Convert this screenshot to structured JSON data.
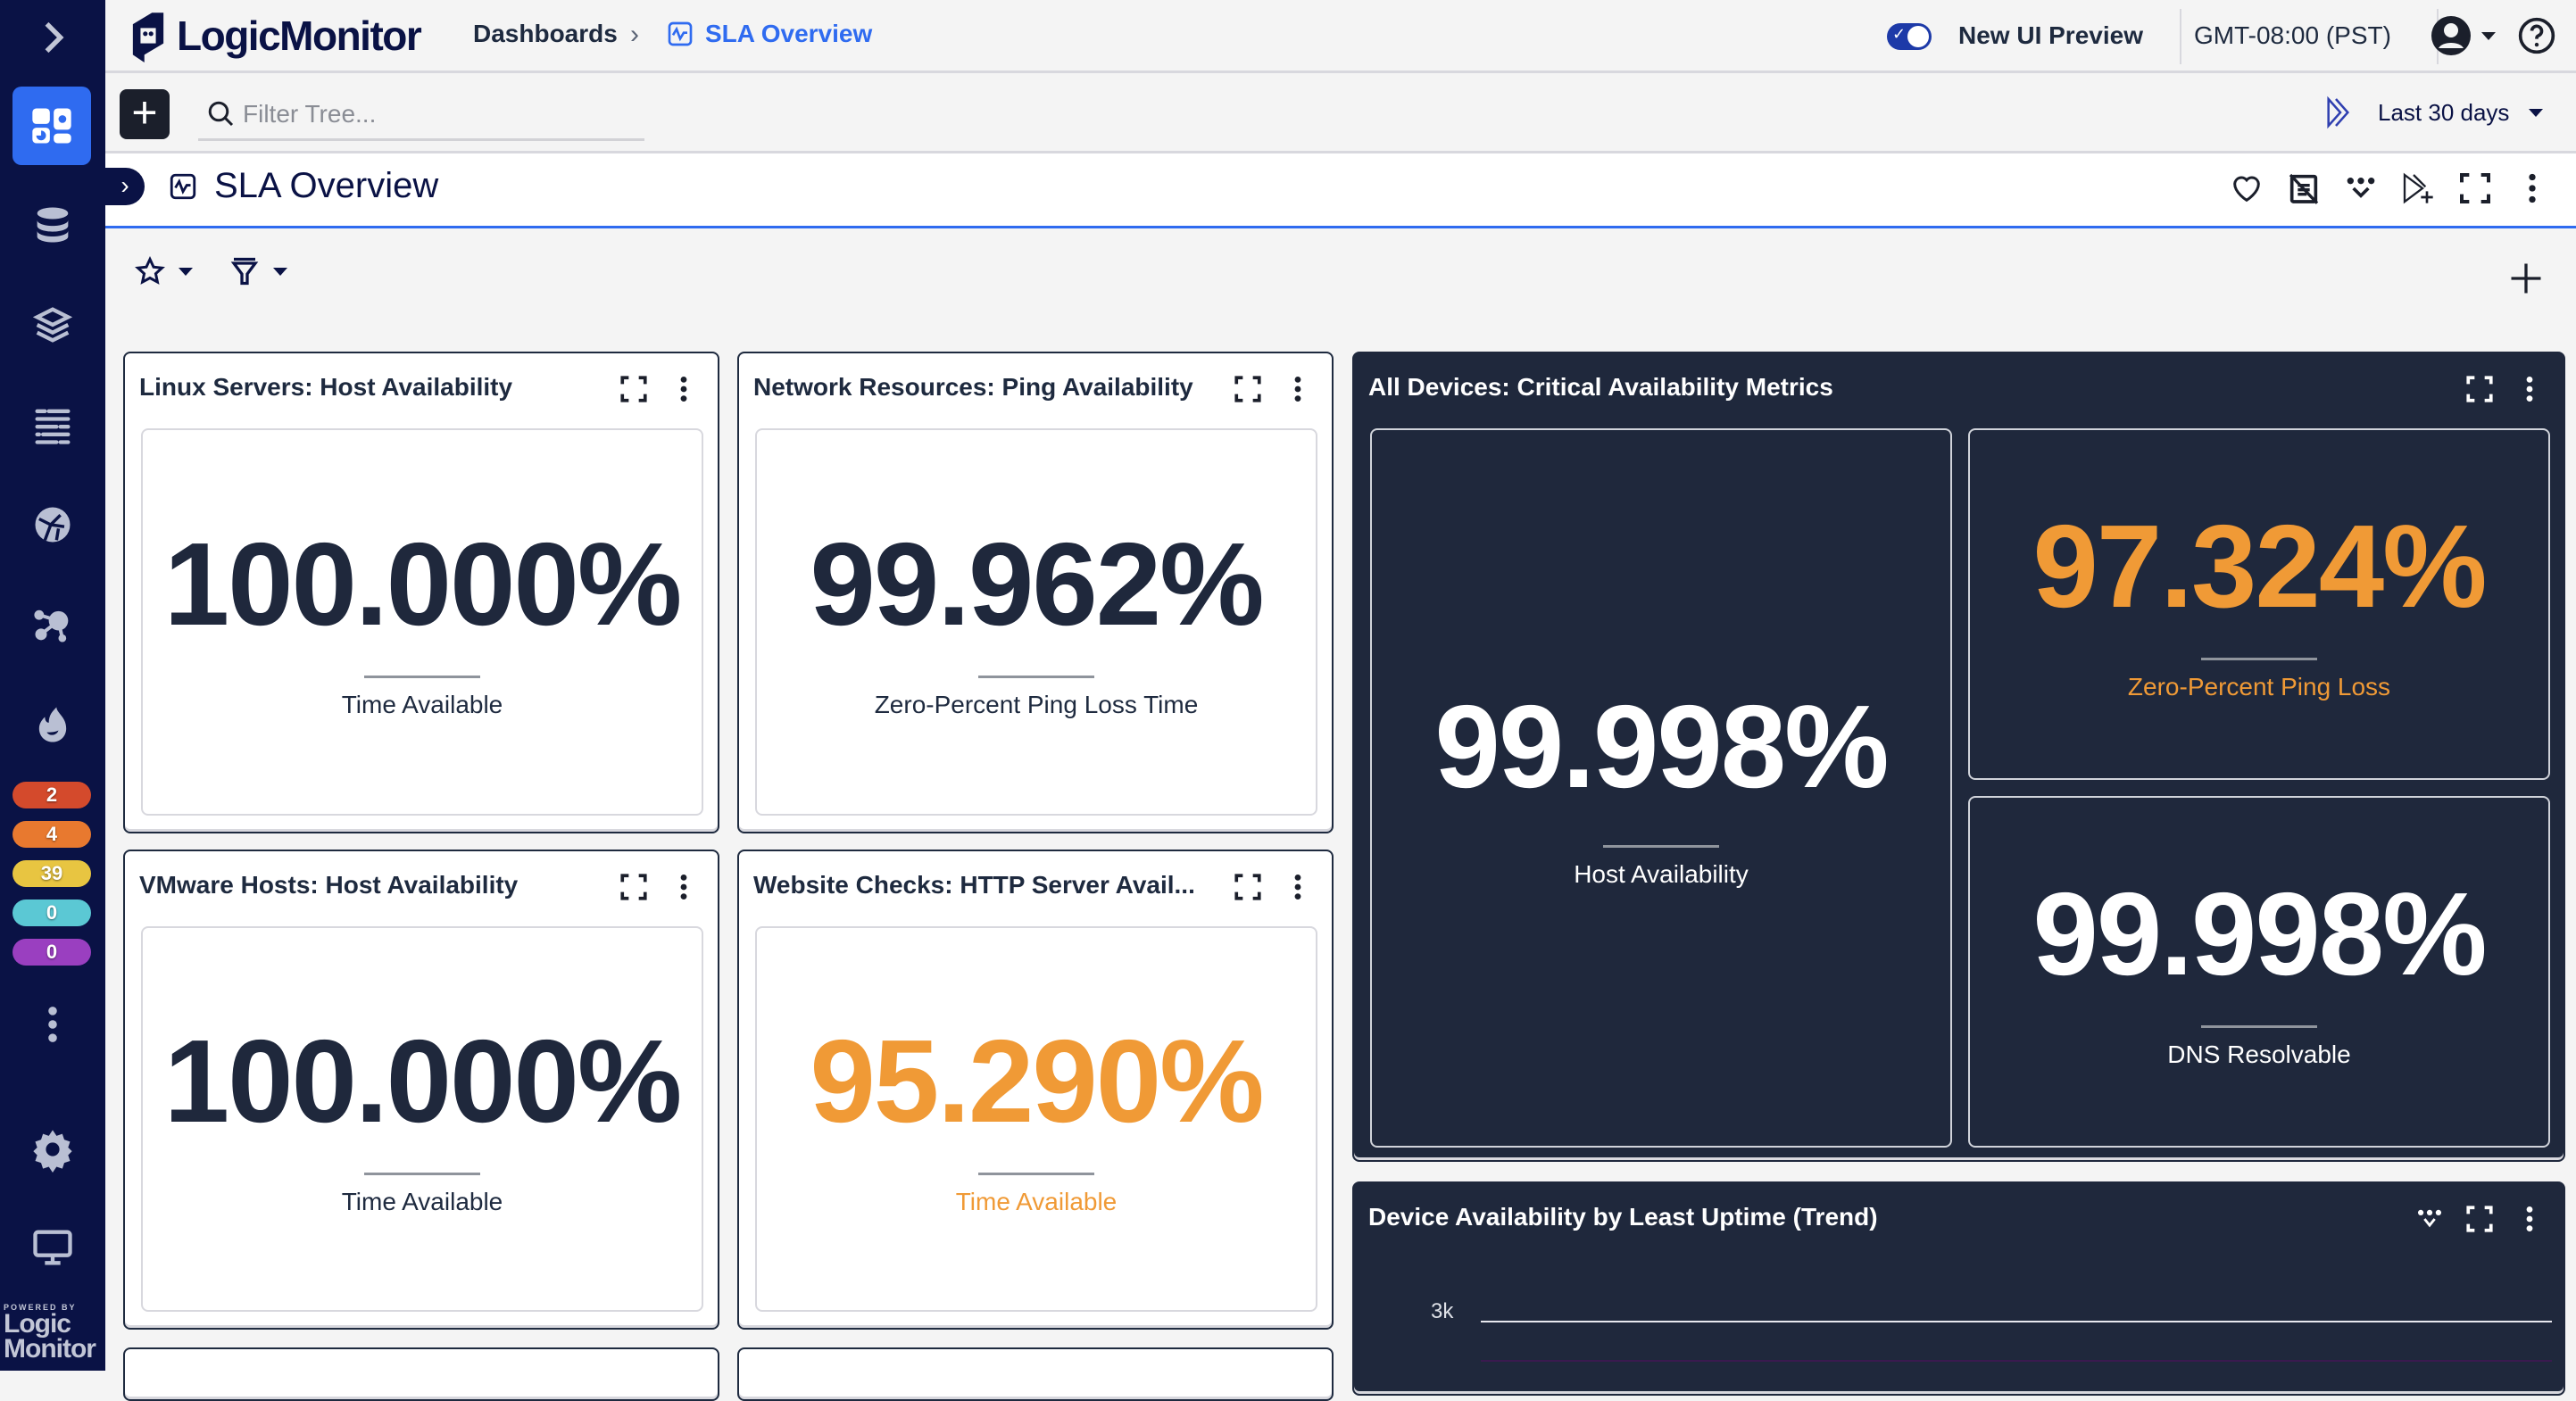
{
  "app": {
    "brand": "LogicMonitor",
    "powered_by": "POWERED BY",
    "powered_logo_line1": "Logic",
    "powered_logo_line2": "Monitor"
  },
  "breadcrumb": {
    "root": "Dashboards",
    "separator": "›",
    "current": "SLA Overview"
  },
  "header": {
    "new_ui_toggle_label": "New UI Preview",
    "new_ui_toggle_on": true,
    "timezone": "GMT-08:00 (PST)"
  },
  "toolbar": {
    "filter_placeholder": "Filter Tree...",
    "filter_value": "",
    "time_range": "Last 30 days"
  },
  "dashboard": {
    "title": "SLA Overview",
    "actions": [
      "favorite-icon",
      "notes-off-icon",
      "more-widgets-icon",
      "add-to-playlist-icon",
      "fullscreen-icon",
      "more-vert-icon"
    ]
  },
  "sidebar": {
    "items": [
      {
        "name": "dashboards",
        "icon": "dashboard-icon",
        "active": true
      },
      {
        "name": "resources",
        "icon": "database-icon"
      },
      {
        "name": "websites",
        "icon": "layers-icon"
      },
      {
        "name": "logs",
        "icon": "logs-icon"
      },
      {
        "name": "topology",
        "icon": "globe-icon"
      },
      {
        "name": "mapping",
        "icon": "network-icon"
      },
      {
        "name": "alerts",
        "icon": "flame-icon"
      }
    ],
    "alert_badges": [
      {
        "label": "2",
        "severity": "critical",
        "color": "#d44a2c"
      },
      {
        "label": "4",
        "severity": "error",
        "color": "#e8792f"
      },
      {
        "label": "39",
        "severity": "warning",
        "color": "#e8c541"
      },
      {
        "label": "0",
        "severity": "info",
        "color": "#5bc8d4"
      },
      {
        "label": "0",
        "severity": "other",
        "color": "#9a3fc0"
      }
    ]
  },
  "widgets": [
    {
      "title": "Linux Servers: Host Availability",
      "value": "100.000%",
      "label": "Time Available",
      "status": "normal"
    },
    {
      "title": "Network Resources: Ping Availability",
      "value": "99.962%",
      "label": "Zero-Percent Ping Loss Time",
      "status": "normal"
    },
    {
      "title": "VMware Hosts: Host Availability",
      "value": "100.000%",
      "label": "Time Available",
      "status": "normal"
    },
    {
      "title": "Website Checks: HTTP Server Avail...",
      "value": "95.290%",
      "label": "Time Available",
      "status": "warning"
    }
  ],
  "critical_metrics": {
    "title": "All Devices: Critical Availability Metrics",
    "tiles": [
      {
        "value": "99.998%",
        "label": "Host Availability",
        "status": "normal"
      },
      {
        "value": "97.324%",
        "label": "Zero-Percent Ping Loss",
        "status": "warning"
      },
      {
        "value": "99.998%",
        "label": "DNS Resolvable",
        "status": "normal"
      }
    ]
  },
  "trend": {
    "title": "Device Availability by Least Uptime (Trend)",
    "y_tick": "3k"
  },
  "colors": {
    "accent": "#2f6bf0",
    "sidebar": "#0a1245",
    "warning": "#f09a36",
    "dark_panel": "#1f283c"
  }
}
